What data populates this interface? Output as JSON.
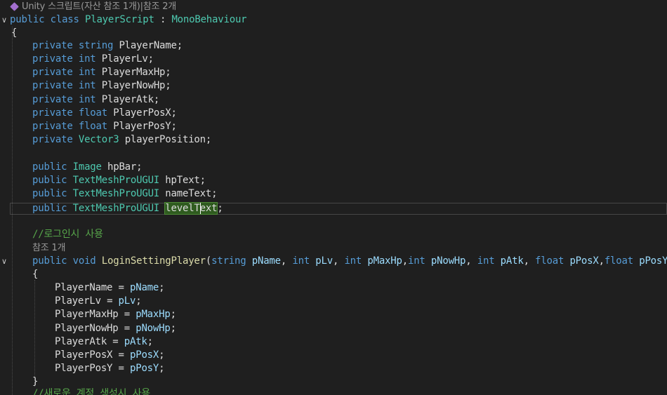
{
  "codelens": {
    "header_text": "Unity 스크립트(자산 참조 1개)|참조 2개",
    "login_refs": "참조 1개"
  },
  "code": {
    "l1_public": "public",
    "l1_class": "class",
    "l1_name": "PlayerScript",
    "l1_colon": " : ",
    "l1_base": "MonoBehaviour",
    "brace_open": "{",
    "brace_close": "}",
    "private": "private",
    "public": "public",
    "t_string": "string",
    "t_int": "int",
    "t_float": "float",
    "t_vector3": "Vector3",
    "t_image": "Image",
    "t_tmp": "TextMeshProUGUI",
    "f_playername": "PlayerName",
    "f_playerlv": "PlayerLv",
    "f_playermaxhp": "PlayerMaxHp",
    "f_playernowhp": "PlayerNowHp",
    "f_playeratk": "PlayerAtk",
    "f_playerposx": "PlayerPosX",
    "f_playerposy": "PlayerPosY",
    "f_playerposition": "playerPosition",
    "f_hpbar": "hpBar",
    "f_hptext": "hpText",
    "f_nametext": "nameText",
    "f_leveltext_a": "levelT",
    "f_leveltext_b": "ext",
    "semi": ";",
    "comment_login": "//로그인시 사용",
    "method_void": "void",
    "method_name": "LoginSettingPlayer",
    "p_open": "(",
    "p_close": ")",
    "p_name": "pName",
    "p_lv": "pLv",
    "p_maxhp": "pMaxHp",
    "p_nowhp": "pNowHp",
    "p_atk": "pAtk",
    "p_posx": "pPosX",
    "p_posy": "pPosY",
    "comma_sp": ", ",
    "comma": ",",
    "assign": " = ",
    "comment_create": "//새로운 계정 생성시 사용"
  }
}
